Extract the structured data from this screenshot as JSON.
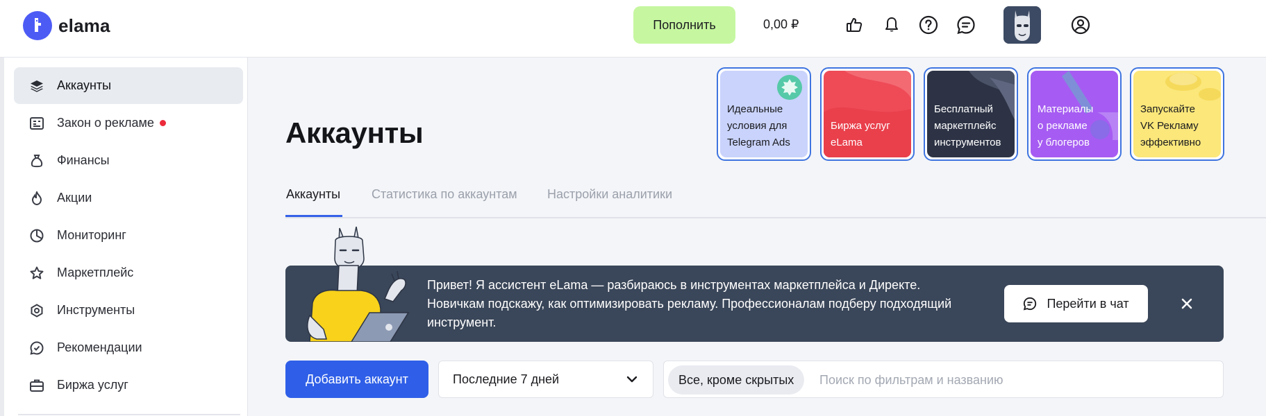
{
  "header": {
    "logo_text": "elama",
    "topup_label": "Пополнить",
    "balance": "0,00 ₽",
    "icons": [
      "thumbs-up-icon",
      "bell-icon",
      "help-icon",
      "chat-icon",
      "avatar",
      "user-icon"
    ]
  },
  "sidebar": {
    "items": [
      {
        "label": "Аккаунты",
        "icon": "layers-icon",
        "active": true
      },
      {
        "label": "Закон о рекламе",
        "icon": "ad-law-icon",
        "badge": "red-dot"
      },
      {
        "label": "Финансы",
        "icon": "money-bag-icon"
      },
      {
        "label": "Акции",
        "icon": "fire-icon"
      },
      {
        "label": "Мониторинг",
        "icon": "pie-chart-icon"
      },
      {
        "label": "Маркетплейс",
        "icon": "star-icon"
      },
      {
        "label": "Инструменты",
        "icon": "hexagon-icon"
      },
      {
        "label": "Рекомендации",
        "icon": "check-circle-icon"
      },
      {
        "label": "Биржа услуг",
        "icon": "briefcase-icon"
      }
    ]
  },
  "main": {
    "title": "Аккаунты",
    "promos": [
      {
        "line1": "Идеальные",
        "line2": "условия для",
        "line3": "Telegram Ads",
        "bg": "#c9d3fb",
        "fg": "#1b1b1f"
      },
      {
        "line1": "Биржа услуг",
        "line2": "eLama",
        "line3": "",
        "bg": "#ee4b57",
        "fg": "#ffffff"
      },
      {
        "line1": "Бесплатный",
        "line2": "маркетплейс",
        "line3": "инструментов",
        "bg": "#2d3345",
        "fg": "#ffffff"
      },
      {
        "line1": "Материалы",
        "line2": "о рекламе",
        "line3": "у блогеров",
        "bg": "#a65cf2",
        "fg": "#ffffff"
      },
      {
        "line1": "Запускайте",
        "line2": "VK Рекламу",
        "line3": "эффективно",
        "bg": "#fbe77a",
        "fg": "#1b1b1f"
      }
    ],
    "tabs": [
      "Аккаунты",
      "Статистика по аккаунтам",
      "Настройки аналитики"
    ],
    "assistant": {
      "line1": "Привет! Я ассистент eLama — разбираюсь в инструментах маркетплейса и Директе.",
      "line2": "Новичкам подскажу, как оптимизировать рекламу. Профессионалам подберу подходящий",
      "line3": "инструмент.",
      "chat_button": "Перейти в чат"
    },
    "toolbar": {
      "add_account": "Добавить аккаунт",
      "period": "Последние 7 дней",
      "filter_chip": "Все, кроме скрытых",
      "search_placeholder": "Поиск по фильтрам и названию"
    }
  },
  "colors": {
    "accent": "#2f5fe8",
    "topup_bg": "#c6f7a0",
    "banner_bg": "#3a4659",
    "red_dot": "#ec2a3a"
  }
}
